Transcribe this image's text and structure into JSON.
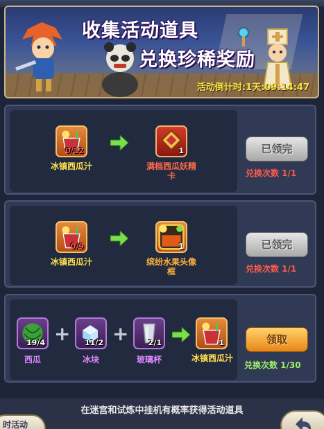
{
  "banner": {
    "title_line1": "收集活动道具",
    "title_line2": "兑换珍稀奖励",
    "countdown": "活动倒计时:1天:09:14:47"
  },
  "exchanges": [
    {
      "inputs": [
        {
          "name": "冰镇西瓜汁",
          "count": "0/12",
          "color": "orange"
        }
      ],
      "output": {
        "name": "满档西瓜妖精卡",
        "count": "1"
      },
      "button": "已领完",
      "times": "兑换次数  1/1"
    },
    {
      "inputs": [
        {
          "name": "冰镇西瓜汁",
          "count": "0/9",
          "color": "orange"
        }
      ],
      "output": {
        "name": "缤纷水果头像框",
        "count": "1"
      },
      "button": "已领完",
      "times": "兑换次数  1/1"
    },
    {
      "inputs": [
        {
          "name": "西瓜",
          "count": "19/4"
        },
        {
          "name": "冰块",
          "count": "11/2"
        },
        {
          "name": "玻璃杯",
          "count": "2/1"
        }
      ],
      "output": {
        "name": "冰镇西瓜汁",
        "count": "1"
      },
      "button": "领取",
      "times": "兑换次数  1/30"
    }
  ],
  "footer": {
    "tip": "在迷宫和试炼中挂机有概率获得活动道具",
    "left_button": "时活动"
  }
}
